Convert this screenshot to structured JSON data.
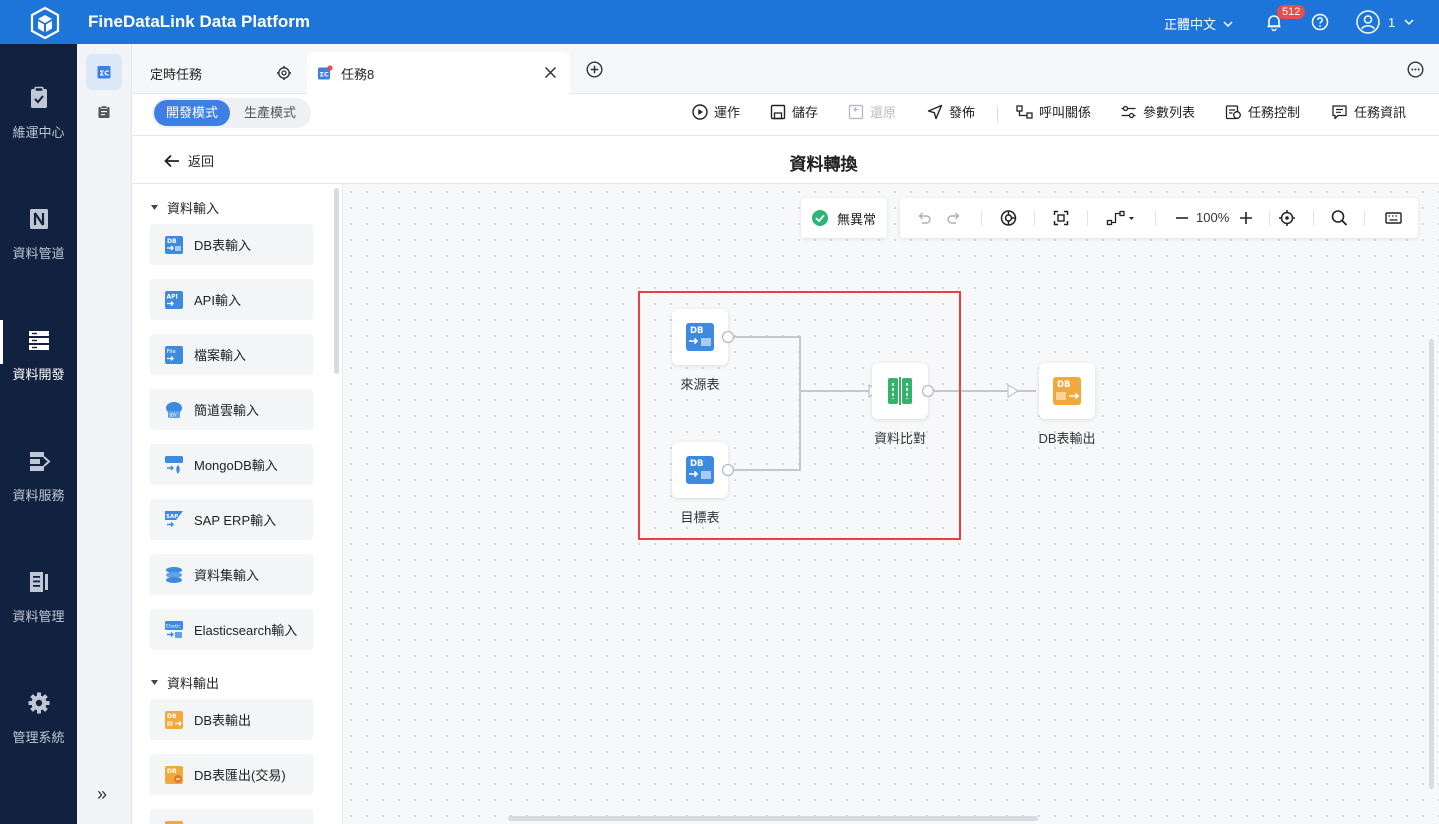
{
  "app": {
    "title": "FineDataLink Data Platform",
    "language": "正體中文",
    "notification_count": "512",
    "user_name": "1"
  },
  "left_nav": {
    "items": [
      {
        "label": "維運中心",
        "icon": "clipboard-check-icon"
      },
      {
        "label": "資料管道",
        "icon": "pipeline-icon"
      },
      {
        "label": "資料開發",
        "icon": "server-icon",
        "active": true
      },
      {
        "label": "資料服務",
        "icon": "service-icon"
      },
      {
        "label": "資料管理",
        "icon": "data-manage-icon"
      },
      {
        "label": "管理系統",
        "icon": "gear-icon"
      }
    ]
  },
  "tabs": [
    {
      "label": "定時任務"
    },
    {
      "label": "任務8",
      "active": true
    }
  ],
  "toolbar": {
    "mode_dev": "開發模式",
    "mode_prod": "生產模式",
    "run": "運作",
    "save": "儲存",
    "restore": "還原",
    "publish": "發佈",
    "call_relation": "呼叫關係",
    "param_list": "參數列表",
    "task_control": "任務控制",
    "task_info": "任務資訊"
  },
  "header": {
    "back": "返回",
    "title": "資料轉換"
  },
  "palette": {
    "group_input": "資料輸入",
    "group_output": "資料輸出",
    "inputs": [
      {
        "label": "DB表輸入",
        "icon": "db-input-icon"
      },
      {
        "label": "API輸入",
        "icon": "api-input-icon"
      },
      {
        "label": "檔案輸入",
        "icon": "file-input-icon"
      },
      {
        "label": "簡道雲輸入",
        "icon": "jdy-input-icon"
      },
      {
        "label": "MongoDB輸入",
        "icon": "mongodb-input-icon"
      },
      {
        "label": "SAP ERP輸入",
        "icon": "sap-input-icon"
      },
      {
        "label": "資料集輸入",
        "icon": "dataset-input-icon"
      },
      {
        "label": "Elasticsearch輸入",
        "icon": "elasticsearch-input-icon"
      }
    ],
    "outputs": [
      {
        "label": "DB表輸出",
        "icon": "db-output-icon"
      },
      {
        "label": "DB表匯出(交易)",
        "icon": "db-export-icon"
      }
    ]
  },
  "canvas": {
    "status": "無異常",
    "zoom": "100%",
    "nodes": [
      {
        "label": "來源表",
        "icon": "db-source-icon"
      },
      {
        "label": "目標表",
        "icon": "db-target-icon"
      },
      {
        "label": "資料比對",
        "icon": "compare-icon"
      },
      {
        "label": "DB表輸出",
        "icon": "db-output-icon"
      }
    ]
  },
  "colors": {
    "brand": "#1E75D9",
    "nav_bg": "#112240",
    "accent": "#3D7FE3",
    "highlight": "#E64040",
    "ok": "#2BB673"
  }
}
